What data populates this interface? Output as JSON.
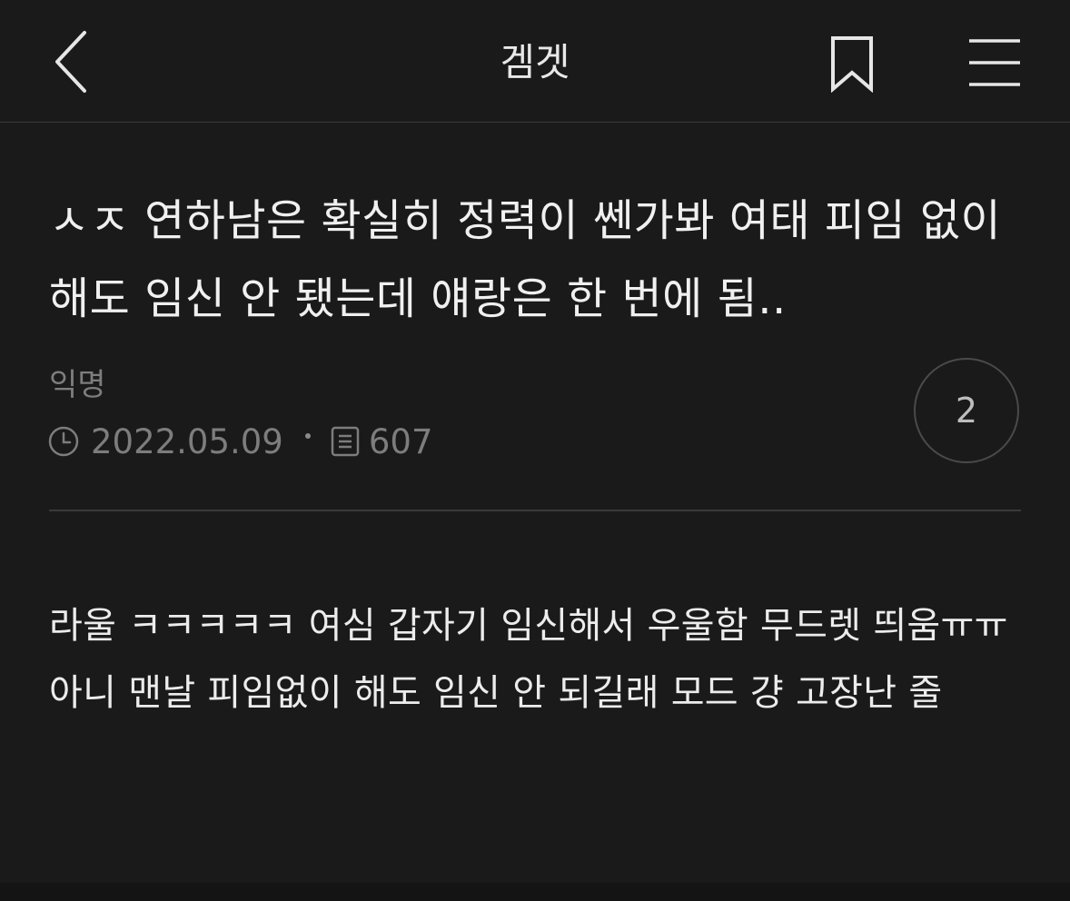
{
  "header": {
    "board_name": "겜겟",
    "back_icon": "chevron-left-icon",
    "bookmark_icon": "bookmark-icon",
    "menu_icon": "hamburger-menu-icon"
  },
  "post": {
    "title": "ㅅㅈ 연하남은 확실히 정력이 쎈가봐 여태 피임 없이 해도 임신 안 됐는데 얘랑은 한 번에 됨..",
    "author": "익명",
    "date": "2022.05.09",
    "views": "607",
    "comment_count": "2",
    "body": "라울 ㅋㅋㅋㅋㅋ 여심 갑자기 임신해서 우울함 무드렛 띄움ㅠㅠ 아니 맨날 피임없이 해도 임신 안 되길래 모드 걍 고장난 줄"
  },
  "colors": {
    "background": "#1a1a1a",
    "text": "#ececec",
    "muted": "#7d7d7d",
    "divider": "#3a3a3a"
  }
}
